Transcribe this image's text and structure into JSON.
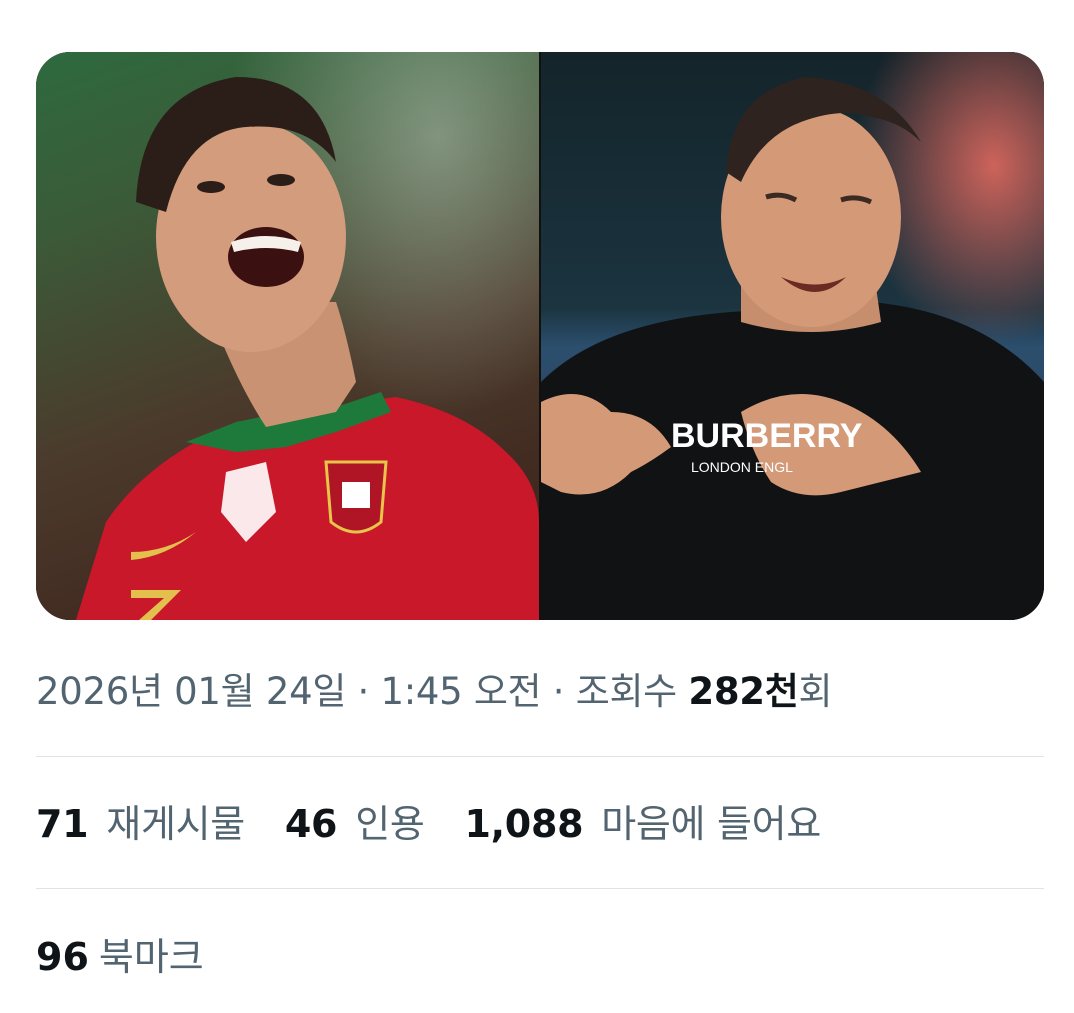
{
  "media": {
    "images": [
      {
        "description": "player-celebrating-photo",
        "jersey_color": "#c8182a"
      },
      {
        "description": "man-in-black-sweatshirt-photo",
        "shirt_text": "BURBERRY",
        "shirt_subtext": "LONDON ENGL"
      }
    ]
  },
  "meta": {
    "date": "2026년 01월 24일",
    "separator": " · ",
    "time": "1:45 오전",
    "views_label": "조회수 ",
    "views_value": "282천",
    "views_suffix": "회"
  },
  "stats": {
    "reposts": {
      "count": "71",
      "label": "재게시물"
    },
    "quotes": {
      "count": "46",
      "label": "인용"
    },
    "likes": {
      "count": "1,088",
      "label": "마음에 들어요"
    },
    "bookmarks": {
      "count": "96",
      "label": "북마크"
    }
  },
  "colors": {
    "text_primary": "#0f1419",
    "text_secondary": "#536471",
    "divider": "#dfe3e6"
  }
}
